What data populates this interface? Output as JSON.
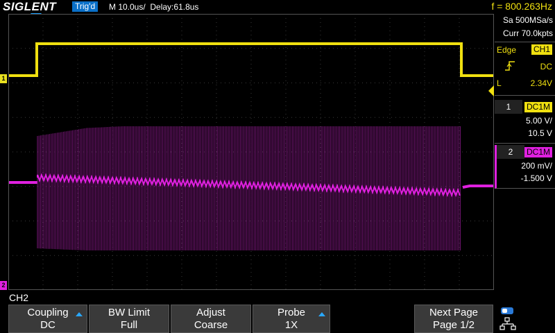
{
  "header": {
    "brand": "SIGLENT",
    "trigger_status": "Trig'd",
    "timebase": "M 10.0us/",
    "delay": "Delay:61.8us",
    "frequency": "f = 800.263Hz"
  },
  "acquisition": {
    "sample_rate": "Sa 500MSa/s",
    "memory": "Curr 70.0kpts"
  },
  "trigger": {
    "type": "Edge",
    "source": "CH1",
    "coupling": "DC",
    "level_label": "L",
    "level": "2.34V",
    "slope_icon": "rising-edge-icon"
  },
  "channels": [
    {
      "num": "1",
      "coupling": "DC1M",
      "scale": "5.00 V/",
      "offset": "10.5 V",
      "color": "#f0e010"
    },
    {
      "num": "2",
      "coupling": "DC1M",
      "scale": "200 mV/",
      "offset": "-1.500 V",
      "color": "#e020e0"
    }
  ],
  "markers": {
    "ch1": "1",
    "ch2": "2"
  },
  "menu": {
    "channel": "CH2",
    "keys": [
      {
        "top": "Coupling",
        "bottom": "DC"
      },
      {
        "top": "BW Limit",
        "bottom": "Full"
      },
      {
        "top": "Adjust",
        "bottom": "Coarse"
      },
      {
        "top": "Probe",
        "bottom": "1X"
      },
      {
        "top": "Next Page",
        "bottom": "Page 1/2"
      }
    ]
  },
  "colors": {
    "ch1": "#f0e010",
    "ch2": "#e020e0",
    "accent": "#0a70c8"
  }
}
